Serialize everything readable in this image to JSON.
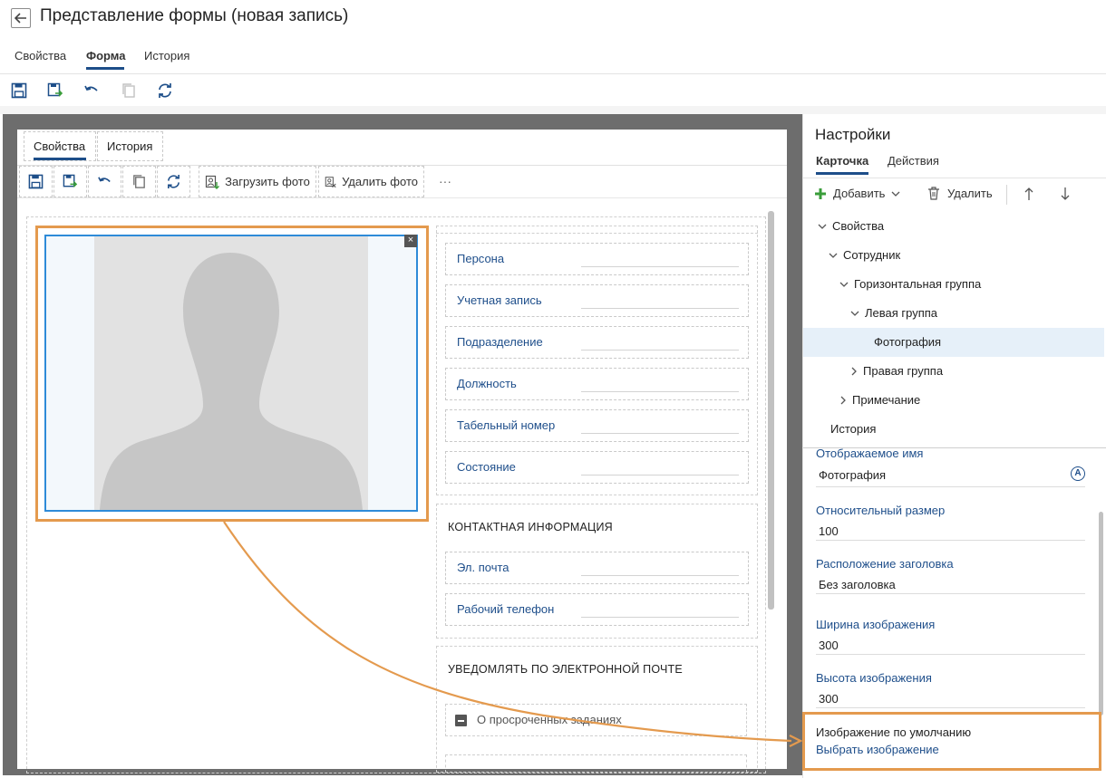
{
  "header": {
    "title": "Представление формы (новая запись)",
    "tabs": [
      {
        "label": "Свойства",
        "active": false
      },
      {
        "label": "Форма",
        "active": true
      },
      {
        "label": "История",
        "active": false
      }
    ]
  },
  "toolbar": {
    "icons": [
      "save-icon",
      "save-and-close-icon",
      "undo-icon",
      "copy-icon",
      "refresh-icon"
    ]
  },
  "form": {
    "tabs": [
      {
        "label": "Свойства",
        "active": true
      },
      {
        "label": "История",
        "active": false
      }
    ],
    "toolbar": {
      "upload_photo": "Загрузить фото",
      "delete_photo": "Удалить фото",
      "more": "···"
    },
    "fields": [
      {
        "label": "Персона"
      },
      {
        "label": "Учетная запись"
      },
      {
        "label": "Подразделение"
      },
      {
        "label": "Должность"
      },
      {
        "label": "Табельный номер"
      },
      {
        "label": "Состояние"
      }
    ],
    "contact_section": {
      "title": "КОНТАКТНАЯ ИНФОРМАЦИЯ",
      "fields": [
        {
          "label": "Эл. почта"
        },
        {
          "label": "Рабочий телефон"
        }
      ]
    },
    "notify_section": {
      "title": "УВЕДОМЛЯТЬ ПО ЭЛЕКТРОННОЙ ПОЧТЕ",
      "checkbox_label": "О просроченных заданиях"
    },
    "photo_remove": "×"
  },
  "settings": {
    "title": "Настройки",
    "tabs": [
      {
        "label": "Карточка",
        "active": true
      },
      {
        "label": "Действия",
        "active": false
      }
    ],
    "toolbar": {
      "add": "Добавить",
      "delete": "Удалить"
    },
    "tree": [
      {
        "label": "Свойства",
        "level": 0,
        "expanded": true
      },
      {
        "label": "Сотрудник",
        "level": 1,
        "expanded": true
      },
      {
        "label": "Горизонтальная группа",
        "level": 2,
        "expanded": true
      },
      {
        "label": "Левая группа",
        "level": 3,
        "expanded": true
      },
      {
        "label": "Фотография",
        "level": 4,
        "selected": true
      },
      {
        "label": "Правая группа",
        "level": 3,
        "expanded": false
      },
      {
        "label": "Примечание",
        "level": 2,
        "expanded": false
      },
      {
        "label": "История",
        "level": 0
      }
    ],
    "properties": {
      "display_name_label": "Отображаемое имя",
      "display_name_value": "Фотография",
      "relative_size_label": "Относительный размер",
      "relative_size_value": "100",
      "title_position_label": "Расположение заголовка",
      "title_position_value": "Без заголовка",
      "image_width_label": "Ширина изображения",
      "image_width_value": "300",
      "image_height_label": "Высота изображения",
      "image_height_value": "300",
      "default_image_label": "Изображение по умолчанию",
      "default_image_link": "Выбрать изображение"
    }
  },
  "colors": {
    "accent": "#1d4e89",
    "link": "#1f4f8b",
    "highlight": "#e49a4e",
    "selected_row": "#e6f0f9",
    "photo_border": "#2e8bd8"
  }
}
